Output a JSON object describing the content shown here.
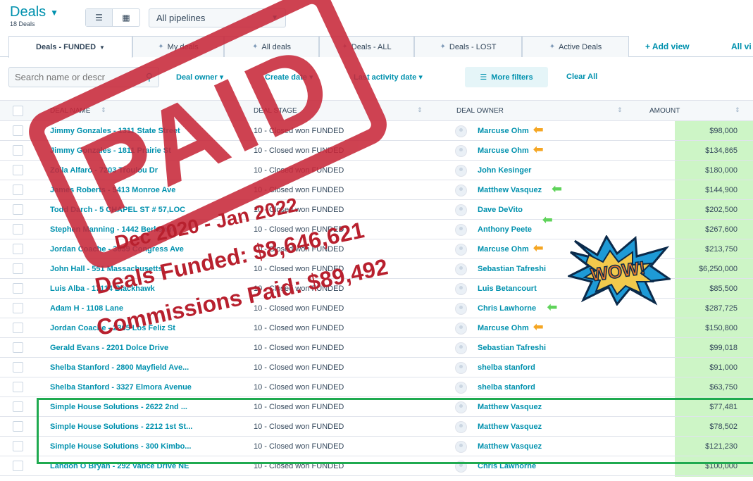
{
  "header": {
    "title": "Deals",
    "count": "18 Deals",
    "pipeline": "All pipelines"
  },
  "tabs": [
    {
      "label": "Deals - FUNDED",
      "active": true
    },
    {
      "label": "My deals"
    },
    {
      "label": "All deals"
    },
    {
      "label": "Deals - ALL"
    },
    {
      "label": "Deals - LOST"
    },
    {
      "label": "Active Deals"
    }
  ],
  "add_view": "+ Add view",
  "all_views": "All vi",
  "filters": {
    "search_placeholder": "Search name or descr",
    "deal_owner": "Deal owner",
    "create_date": "Create date",
    "last_activity": "Last activity date",
    "more_filters": "More filters",
    "clear_all": "Clear All"
  },
  "columns": {
    "name": "DEAL NAME",
    "stage": "DEAL STAGE",
    "owner": "DEAL OWNER",
    "amount": "AMOUNT"
  },
  "rows": [
    {
      "name": "Jimmy Gonzales - 1311 State Street",
      "stage": "10 - Closed won FUNDED",
      "owner": "Marcuse Ohm",
      "amount": "$98,000",
      "arrow": "orange"
    },
    {
      "name": "Jimmy Gonzales - 1811 Prairie St",
      "stage": "10 - Closed won FUNDED",
      "owner": "Marcuse Ohm",
      "amount": "$134,865",
      "arrow": "orange"
    },
    {
      "name": "Zoila Alfaro - 7203 Troulou Dr",
      "stage": "10 - Closed won FUNDED",
      "owner": "John Kesinger",
      "amount": "$180,000",
      "arrow": ""
    },
    {
      "name": "James Roberts - 5413 Monroe Ave",
      "stage": "10 - Closed won FUNDED",
      "owner": "Matthew Vasquez",
      "amount": "$144,900",
      "arrow": "green"
    },
    {
      "name": "Todd Darch - 5 CHAPEL ST # 57,LOC",
      "stage": "10 - Closed won FUNDED",
      "owner": "Dave DeVito",
      "amount": "$202,500",
      "arrow": ""
    },
    {
      "name": "Stephen Manning - 1442 Berkshire",
      "stage": "10 - Closed won FUNDED",
      "owner": "Anthony Peete",
      "amount": "$267,600",
      "arrow": "green"
    },
    {
      "name": "Jordan Coache - 3039 Congress Ave",
      "stage": "10 - Closed won FUNDED",
      "owner": "Marcuse Ohm",
      "amount": "$213,750",
      "arrow": "orange"
    },
    {
      "name": "John Hall - 551 Massachusetts",
      "stage": "10 - Closed won FUNDED",
      "owner": "Sebastian Tafreshi",
      "amount": "$6,250,000",
      "arrow": ""
    },
    {
      "name": "Luis Alba - 17114 Blackhawk",
      "stage": "10 - Closed won FUNDED",
      "owner": "Luis Betancourt",
      "amount": "$85,500",
      "arrow": ""
    },
    {
      "name": "Adam H - 1108 Lane",
      "stage": "10 - Closed won FUNDED",
      "owner": "Chris Lawhorne",
      "amount": "$287,725",
      "arrow": "green"
    },
    {
      "name": "Jordan Coache - 2365 Los Feliz St",
      "stage": "10 - Closed won FUNDED",
      "owner": "Marcuse Ohm",
      "amount": "$150,800",
      "arrow": "orange"
    },
    {
      "name": "Gerald Evans - 2201 Dolce Drive",
      "stage": "10 - Closed won FUNDED",
      "owner": "Sebastian Tafreshi",
      "amount": "$99,018",
      "arrow": ""
    },
    {
      "name": "Shelba Stanford - 2800 Mayfield Ave...",
      "stage": "10 - Closed won FUNDED",
      "owner": "shelba stanford",
      "amount": "$91,000",
      "arrow": ""
    },
    {
      "name": "Shelba Stanford - 3327 Elmora Avenue",
      "stage": "10 - Closed won FUNDED",
      "owner": "shelba stanford",
      "amount": "$63,750",
      "arrow": ""
    },
    {
      "name": "Simple House Solutions - 2622 2nd ...",
      "stage": "10 - Closed won FUNDED",
      "owner": "Matthew Vasquez",
      "amount": "$77,481",
      "arrow": ""
    },
    {
      "name": "Simple House Solutions - 2212 1st St...",
      "stage": "10 - Closed won FUNDED",
      "owner": "Matthew Vasquez",
      "amount": "$78,502",
      "arrow": ""
    },
    {
      "name": "Simple House Solutions - 300 Kimbo...",
      "stage": "10 - Closed won FUNDED",
      "owner": "Matthew Vasquez",
      "amount": "$121,230",
      "arrow": ""
    },
    {
      "name": "Landon O Bryan - 292 Vance Drive NE",
      "stage": "10 - Closed won FUNDED",
      "owner": "Chris Lawhorne",
      "amount": "$100,000",
      "arrow": ""
    }
  ],
  "overlay": {
    "stamp": "PAID",
    "line1": "Dec 2020 - Jan 2022",
    "line2": "Deals Funded: $8,646,621",
    "line3": "Commissions Paid: $89,492",
    "wow": "WOW!"
  },
  "colors": {
    "accent": "#0091ae",
    "stamp_red": "#c8283a",
    "amount_green": "#cdf5c6",
    "highlight_green": "#1faa50",
    "arrow_orange": "#f5a623",
    "arrow_green": "#5fd35a"
  }
}
